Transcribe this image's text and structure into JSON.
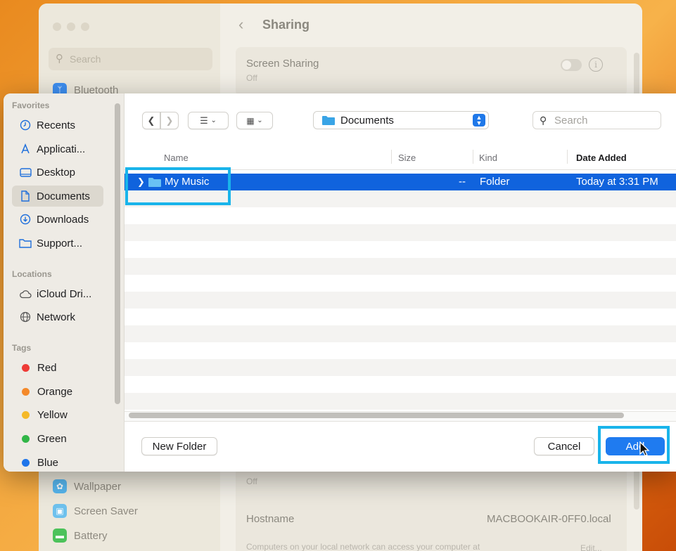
{
  "background": {
    "search_placeholder": "Search",
    "sidebar_items_top": [
      {
        "label": "Bluetooth",
        "color": "#3d8ef0",
        "icon": "bluetooth-icon"
      }
    ],
    "sidebar_items_bottom": [
      {
        "label": "Wallpaper",
        "color": "#57b7ef",
        "icon": "wallpaper-icon"
      },
      {
        "label": "Screen Saver",
        "color": "#6ec1ed",
        "icon": "screen-saver-icon"
      },
      {
        "label": "Battery",
        "color": "#4cc25a",
        "icon": "battery-icon"
      }
    ],
    "page_title": "Sharing",
    "screen_sharing_label": "Screen Sharing",
    "screen_sharing_status": "Off",
    "lower_status": "Off",
    "hostname_label": "Hostname",
    "hostname_value": "MACBOOKAIR-0FF0.local",
    "footnote": "Computers on your local network can access your computer at",
    "edit_label": "Edit..."
  },
  "dialog": {
    "sidebar": {
      "favorites_header": "Favorites",
      "favorites": [
        {
          "label": "Recents",
          "icon": "clock-icon"
        },
        {
          "label": "Applicati...",
          "icon": "applications-icon"
        },
        {
          "label": "Desktop",
          "icon": "desktop-icon"
        },
        {
          "label": "Documents",
          "icon": "document-icon",
          "active": true
        },
        {
          "label": "Downloads",
          "icon": "download-icon"
        },
        {
          "label": "Support...",
          "icon": "folder-icon"
        }
      ],
      "locations_header": "Locations",
      "locations": [
        {
          "label": "iCloud Dri...",
          "icon": "cloud-icon"
        },
        {
          "label": "Network",
          "icon": "globe-icon"
        }
      ],
      "tags_header": "Tags",
      "tags": [
        {
          "label": "Red",
          "color": "#ee3b36"
        },
        {
          "label": "Orange",
          "color": "#f4892a"
        },
        {
          "label": "Yellow",
          "color": "#f5b928"
        },
        {
          "label": "Green",
          "color": "#31b647"
        },
        {
          "label": "Blue",
          "color": "#1f75ea"
        }
      ]
    },
    "toolbar": {
      "location": "Documents",
      "search_placeholder": "Search"
    },
    "columns": {
      "name": "Name",
      "size": "Size",
      "kind": "Kind",
      "date_added": "Date Added"
    },
    "rows": [
      {
        "name": "My Music",
        "size": "--",
        "kind": "Folder",
        "date_added": "Today at 3:31 PM",
        "selected": true
      }
    ],
    "buttons": {
      "new_folder": "New Folder",
      "cancel": "Cancel",
      "add": "Add"
    },
    "accent_color": "#1063dd",
    "highlight_color": "#19b4ea"
  }
}
